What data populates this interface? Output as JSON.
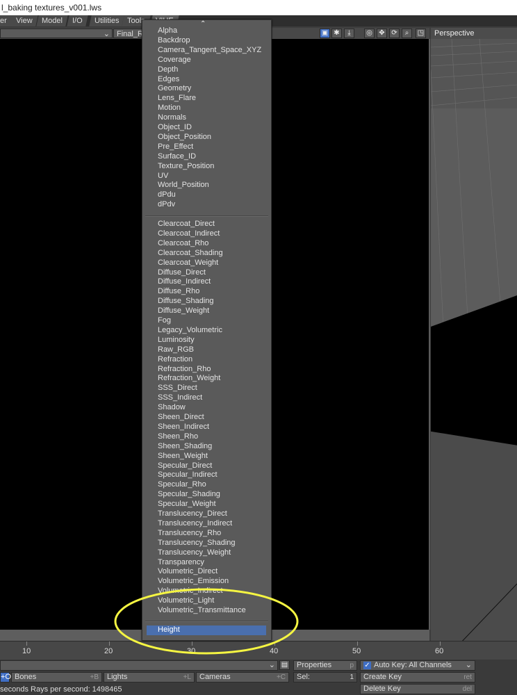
{
  "title": "l_baking textures_v001.lws",
  "menu_tabs": [
    "er",
    "View",
    "Model",
    "I/O",
    "Utilities",
    "Tools",
    "VIUE"
  ],
  "left_viewport": {
    "selector": "Final_Re"
  },
  "right_viewport": {
    "title": "Perspective"
  },
  "dropdown": {
    "group1": [
      "Alpha",
      "Backdrop",
      "Camera_Tangent_Space_XYZ",
      "Coverage",
      "Depth",
      "Edges",
      "Geometry",
      "Lens_Flare",
      "Motion",
      "Normals",
      "Object_ID",
      "Object_Position",
      "Pre_Effect",
      "Surface_ID",
      "Texture_Position",
      "UV",
      "World_Position",
      "dPdu",
      "dPdv"
    ],
    "group2": [
      "Clearcoat_Direct",
      "Clearcoat_Indirect",
      "Clearcoat_Rho",
      "Clearcoat_Shading",
      "Clearcoat_Weight",
      "Diffuse_Direct",
      "Diffuse_Indirect",
      "Diffuse_Rho",
      "Diffuse_Shading",
      "Diffuse_Weight",
      "Fog",
      "Legacy_Volumetric",
      "Luminosity",
      "Raw_RGB",
      "Refraction",
      "Refraction_Rho",
      "Refraction_Weight",
      "SSS_Direct",
      "SSS_Indirect",
      "Shadow",
      "Sheen_Direct",
      "Sheen_Indirect",
      "Sheen_Rho",
      "Sheen_Shading",
      "Sheen_Weight",
      "Specular_Direct",
      "Specular_Indirect",
      "Specular_Rho",
      "Specular_Shading",
      "Specular_Weight",
      "Translucency_Direct",
      "Translucency_Indirect",
      "Translucency_Rho",
      "Translucency_Shading",
      "Translucency_Weight",
      "Transparency",
      "Volumetric_Direct",
      "Volumetric_Emission",
      "Volumetric_Indirect",
      "Volumetric_Light",
      "Volumetric_Transmittance"
    ],
    "selected": "Height"
  },
  "timeline": {
    "ticks": [
      "10",
      "20",
      "30",
      "40",
      "50",
      "60"
    ]
  },
  "toolbar": {
    "bones": "Bones",
    "bones_sc": "+B",
    "lights": "Lights",
    "lights_sc": "+L",
    "cameras": "Cameras",
    "cameras_sc": "+C",
    "properties": "Properties",
    "properties_sc": "p",
    "sel_label": "Sel:",
    "sel_value": "1",
    "autokey": "Auto Key: All Channels",
    "create_key": "Create Key",
    "create_key_sc": "ret",
    "delete_key": "Delete Key",
    "delete_key_sc": "del",
    "status": "seconds  Rays per second: 1498465",
    "left_marker": "+O"
  },
  "colors": {
    "highlight": "#4a6fae",
    "annotation": "#f5f542",
    "blue_icon": "#3f6ec4"
  }
}
